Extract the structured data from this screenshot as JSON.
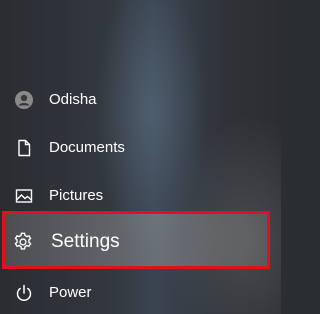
{
  "menu": {
    "user": {
      "label": "Odisha",
      "icon": "user-avatar-icon"
    },
    "documents": {
      "label": "Documents",
      "icon": "document-icon"
    },
    "pictures": {
      "label": "Pictures",
      "icon": "picture-icon"
    },
    "settings": {
      "label": "Settings",
      "icon": "gear-icon",
      "highlight_color": "#e0101e"
    },
    "power": {
      "label": "Power",
      "icon": "power-icon"
    }
  }
}
